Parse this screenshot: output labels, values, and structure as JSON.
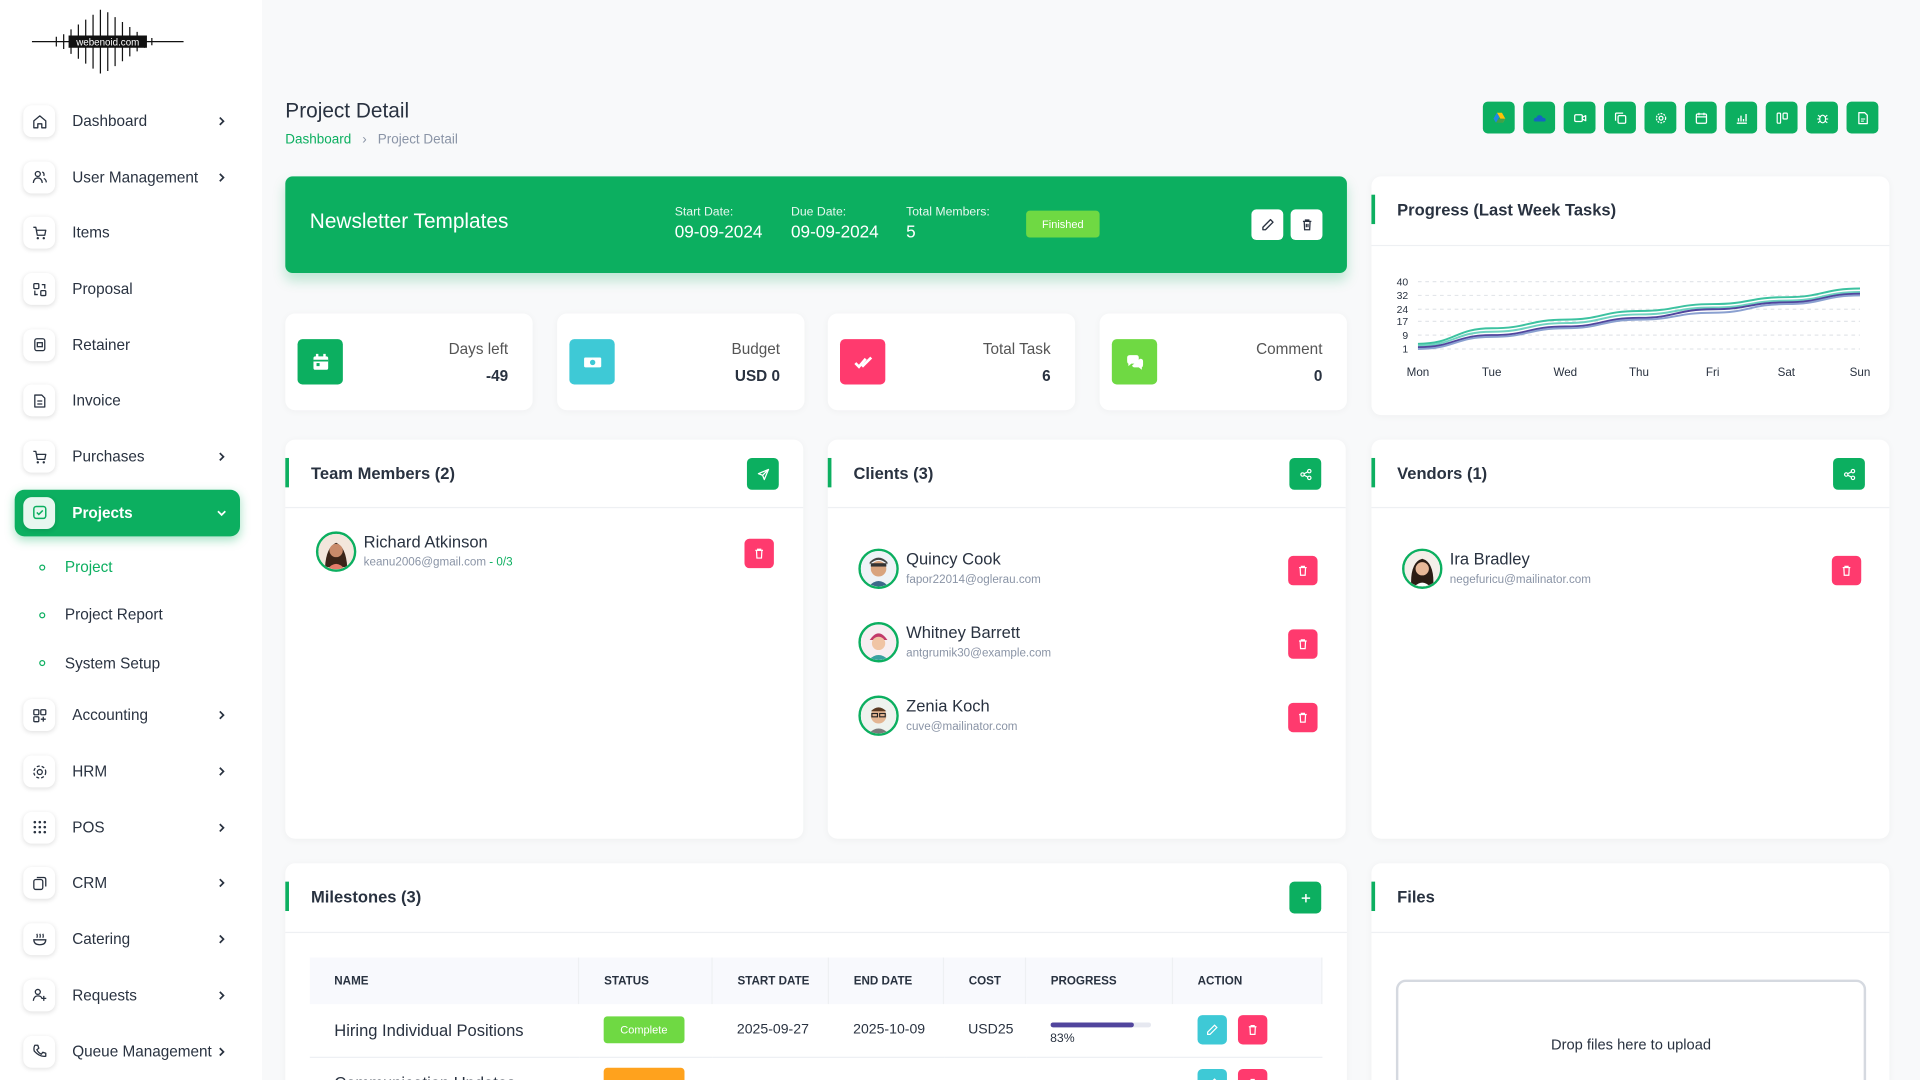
{
  "brand": {
    "logo_text": "webenoid.com"
  },
  "sidebar": {
    "items": [
      {
        "label": "Dashboard",
        "icon": "home-icon",
        "arrow": "right"
      },
      {
        "label": "User Management",
        "icon": "users-icon",
        "arrow": "right"
      },
      {
        "label": "Items",
        "icon": "cart-icon",
        "arrow": ""
      },
      {
        "label": "Proposal",
        "icon": "proposal-icon",
        "arrow": ""
      },
      {
        "label": "Retainer",
        "icon": "retainer-icon",
        "arrow": ""
      },
      {
        "label": "Invoice",
        "icon": "invoice-icon",
        "arrow": ""
      },
      {
        "label": "Purchases",
        "icon": "cart-icon",
        "arrow": "right"
      },
      {
        "label": "Projects",
        "icon": "checkbox-icon",
        "arrow": "down",
        "active": true
      },
      {
        "label": "Accounting",
        "icon": "grid-icon",
        "arrow": "right"
      },
      {
        "label": "HRM",
        "icon": "hrm-icon",
        "arrow": "right"
      },
      {
        "label": "POS",
        "icon": "dots-grid-icon",
        "arrow": "right"
      },
      {
        "label": "CRM",
        "icon": "crm-icon",
        "arrow": "right"
      },
      {
        "label": "Catering",
        "icon": "catering-icon",
        "arrow": "right"
      },
      {
        "label": "Requests",
        "icon": "user-request-icon",
        "arrow": "right"
      },
      {
        "label": "Queue Management",
        "icon": "phone-icon",
        "arrow": "right"
      }
    ],
    "sub_items": [
      {
        "label": "Project",
        "active": true
      },
      {
        "label": "Project Report"
      },
      {
        "label": "System Setup"
      }
    ]
  },
  "header": {
    "title": "Project Detail",
    "breadcrumb": {
      "home": "Dashboard",
      "sep": "›",
      "current": "Project Detail"
    }
  },
  "top_actions": [
    "google-drive-icon",
    "onedrive-icon",
    "video-icon",
    "copy-icon",
    "gear-icon",
    "calendar-icon",
    "chart-icon",
    "kanban-icon",
    "bug-icon",
    "file-icon"
  ],
  "banner": {
    "title": "Newsletter Templates",
    "start_label": "Start Date:",
    "start_value": "09-09-2024",
    "due_label": "Due Date:",
    "due_value": "09-09-2024",
    "members_label": "Total Members:",
    "members_value": "5",
    "status": "Finished"
  },
  "stats": [
    {
      "label": "Days left",
      "value": "-49",
      "icon": "calendar-icon",
      "color": "#0caf60"
    },
    {
      "label": "Budget",
      "value": "USD 0",
      "icon": "money-icon",
      "color": "#3ec9d6"
    },
    {
      "label": "Total Task",
      "value": "6",
      "icon": "check-double-icon",
      "color": "#ff3a6e"
    },
    {
      "label": "Comment",
      "value": "0",
      "icon": "comments-icon",
      "color": "#6fd943"
    }
  ],
  "progress_chart": {
    "title": "Progress (Last Week Tasks)"
  },
  "chart_data": {
    "type": "line",
    "categories": [
      "Mon",
      "Tue",
      "Wed",
      "Thu",
      "Fri",
      "Sat",
      "Sun"
    ],
    "yticks": [
      1,
      9,
      17,
      24,
      32,
      40
    ],
    "ylim": [
      1,
      40
    ],
    "series": [
      {
        "values": [
          4,
          13,
          18,
          23,
          27,
          31,
          36
        ],
        "color": "#3cc2a0"
      },
      {
        "values": [
          3,
          11,
          16,
          21,
          25,
          29,
          34
        ],
        "color": "#6fd2c0"
      },
      {
        "values": [
          2,
          9,
          14,
          19,
          24,
          28,
          33
        ],
        "color": "#51459d"
      },
      {
        "values": [
          1,
          8,
          13,
          18,
          22,
          27,
          32
        ],
        "color": "#8aa0d0"
      }
    ]
  },
  "team": {
    "title": "Team Members (2)",
    "members": [
      {
        "name": "Richard Atkinson",
        "email": "keanu2006@gmail.com",
        "fraction": " - 0/3"
      }
    ]
  },
  "clients": {
    "title": "Clients (3)",
    "members": [
      {
        "name": "Quincy Cook",
        "email": "fapor22014@oglerau.com"
      },
      {
        "name": "Whitney Barrett",
        "email": "antgrumik30@example.com"
      },
      {
        "name": "Zenia Koch",
        "email": "cuve@mailinator.com"
      }
    ]
  },
  "vendors": {
    "title": "Vendors (1)",
    "members": [
      {
        "name": "Ira Bradley",
        "email": "negefuricu@mailinator.com"
      }
    ]
  },
  "milestones": {
    "title": "Milestones (3)",
    "columns": [
      "NAME",
      "STATUS",
      "START DATE",
      "END DATE",
      "COST",
      "PROGRESS",
      "ACTION"
    ],
    "rows": [
      {
        "name": "Hiring Individual Positions",
        "status": "Complete",
        "status_color": "#6fd943",
        "start": "2025-09-27",
        "end": "2025-10-09",
        "cost": "USD25",
        "progress": 83,
        "progress_text": "83%"
      },
      {
        "name": "Communication Updates",
        "status": "",
        "status_color": "#ffa21d",
        "start": "",
        "end": "",
        "cost": "",
        "progress": 0,
        "progress_text": ""
      }
    ]
  },
  "files": {
    "title": "Files",
    "dropzone": "Drop files here to upload"
  }
}
